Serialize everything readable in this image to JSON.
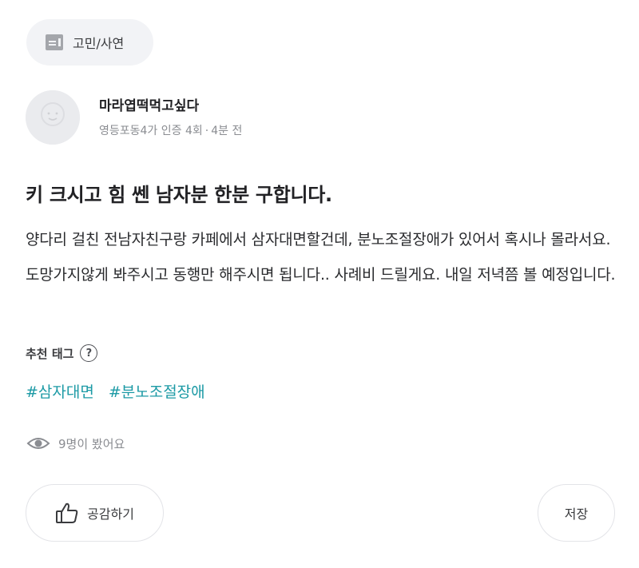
{
  "category": {
    "label": "고민/사연",
    "icon": "list-board-icon"
  },
  "author": {
    "nickname": "마라엽떡먹고싶다",
    "neighborhood": "영등포동4가",
    "verification": "인증 4회",
    "separator": "·",
    "posted_ago": "4분 전",
    "avatar_icon": "default-avatar-icon"
  },
  "post": {
    "title": "키 크시고 힘 쎈 남자분 한분 구합니다.",
    "body": "양다리 걸친 전남자친구랑 카페에서 삼자대면할건데, 분노조절장애가 있어서 혹시나 몰라서요. 도망가지않게 봐주시고 동행만 해주시면 됩니다.. 사례비 드릴게요. 내일 저녁쯤 볼 예정입니다."
  },
  "tags": {
    "label": "추천 태그",
    "help_symbol": "?",
    "items": [
      "#삼자대면",
      "#분노조절장애"
    ]
  },
  "views": {
    "text": "9명이 봤어요",
    "icon": "eye-icon"
  },
  "actions": {
    "like_label": "공감하기",
    "save_label": "저장",
    "like_icon": "thumbs-up-icon"
  },
  "colors": {
    "tag": "#1c9aa5",
    "chip_bg": "#f2f3f6",
    "muted_text": "#8a8c91"
  }
}
